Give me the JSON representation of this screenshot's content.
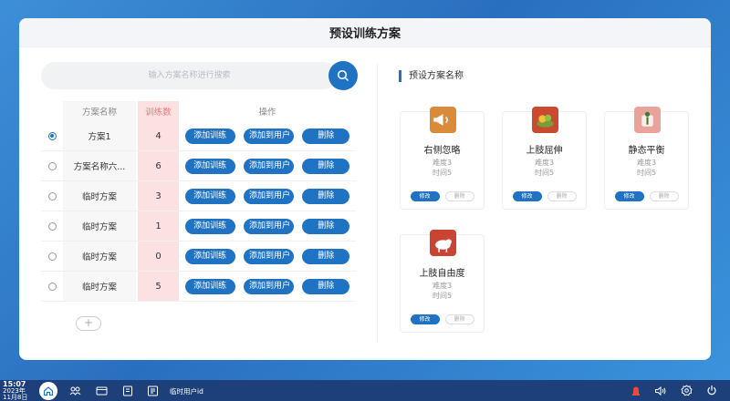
{
  "panel": {
    "title": "预设训练方案"
  },
  "search": {
    "placeholder": "输入方案名称进行搜索"
  },
  "table": {
    "headers": {
      "name": "方案名称",
      "count": "训练数",
      "ops": "操作"
    },
    "buttons": {
      "add_training": "添加训练",
      "add_to_user": "添加到用户",
      "delete": "删除"
    },
    "rows": [
      {
        "name": "方案1",
        "count": "4",
        "selected": true
      },
      {
        "name": "方案名称六...",
        "count": "6",
        "selected": false
      },
      {
        "name": "临时方案",
        "count": "3",
        "selected": false
      },
      {
        "name": "临时方案",
        "count": "1",
        "selected": false
      },
      {
        "name": "临时方案",
        "count": "0",
        "selected": false
      },
      {
        "name": "临时方案",
        "count": "5",
        "selected": false
      }
    ],
    "add_label": "+"
  },
  "right": {
    "title": "预设方案名称",
    "edit_label": "修改",
    "delete_label": "删除",
    "cards": [
      {
        "name": "右侧忽略",
        "difficulty": "难度3",
        "time": "时间5",
        "icon": "megaphone-icon",
        "color": "#d98b3a"
      },
      {
        "name": "上肢屈伸",
        "difficulty": "难度3",
        "time": "时间5",
        "icon": "fruit-basket-icon",
        "color": "#c94a2e"
      },
      {
        "name": "静态平衡",
        "difficulty": "难度3",
        "time": "时间5",
        "icon": "balance-figure-icon",
        "color": "#e9a39a"
      },
      {
        "name": "上肢自由度",
        "difficulty": "难度3",
        "time": "时间5",
        "icon": "sheep-icon",
        "color": "#c94432"
      }
    ]
  },
  "taskbar": {
    "time": "15:07",
    "date_line1": "2023年",
    "date_line2": "11月8日",
    "user": "临时用户id",
    "icons": [
      "home-icon",
      "group-icon",
      "folder-icon",
      "report-icon",
      "document-icon",
      "alert-icon",
      "volume-icon",
      "settings-icon",
      "power-icon"
    ]
  },
  "colors": {
    "primary": "#1f73c2",
    "count_bg": "#fbe1e1",
    "background": "#3d8fd6"
  }
}
